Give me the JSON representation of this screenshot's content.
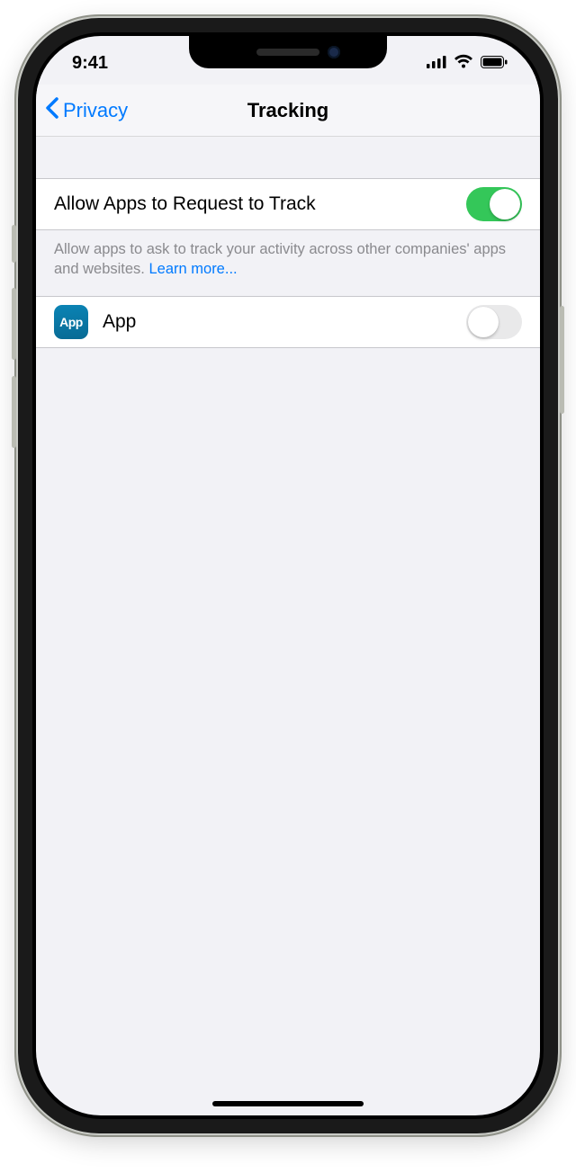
{
  "status_bar": {
    "time": "9:41"
  },
  "nav": {
    "back_label": "Privacy",
    "title": "Tracking"
  },
  "rows": {
    "allow_tracking": {
      "label": "Allow Apps to Request to Track",
      "enabled": true
    },
    "app": {
      "icon_text": "App",
      "label": "App",
      "enabled": false
    }
  },
  "footer": {
    "text": "Allow apps to ask to track your activity across other companies' apps and websites. ",
    "link": "Learn more..."
  }
}
